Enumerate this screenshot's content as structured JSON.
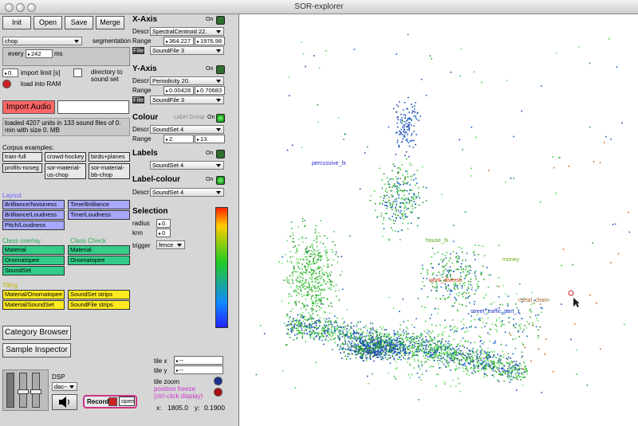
{
  "window": {
    "title": "SOR-explorer"
  },
  "toolbar": {
    "init": "Init",
    "open": "Open",
    "save": "Save",
    "merge": "Merge"
  },
  "segmentation": {
    "method": "chop",
    "label": "segmentation",
    "every_label": "every",
    "every_value": "242",
    "unit": "ms"
  },
  "import": {
    "limit_value": "0.",
    "limit_label": "import limit [s]",
    "dir_label": "directory to sound set",
    "ram_label": "load into RAM",
    "button": "Import Audio",
    "status": "loaded 4207 units in 133 sound files of 0. min with size 0. MB"
  },
  "corpus": {
    "title": "Corpus examples:",
    "items": [
      "train-full",
      "crowd-hockey",
      "birds+planes",
      "profils-noseg",
      "sor-material-us-chop",
      "sor-material-bb-chop"
    ]
  },
  "layout": {
    "title": "Layout",
    "items": [
      "Brilliance/Noisiness",
      "Time/Brilliance",
      "Brilliance/Loudness",
      "Time/Loudness",
      "Pitch/Loudness"
    ],
    "color": "#8b82ff"
  },
  "class_overlay": {
    "title": "Class overlay",
    "items": [
      "Material",
      "Onomatopee",
      "SoundSet"
    ],
    "color": "#33cc66"
  },
  "class_check": {
    "title": "Class Check",
    "items": [
      "Material",
      "Onomatopee"
    ],
    "color": "#33cc66"
  },
  "tiling": {
    "title": "Tiling",
    "items": [
      "Material/Onomatopee",
      "SoundSet strips",
      "Material/SoundSet",
      "SoundFile strips"
    ],
    "color": "#ddc400"
  },
  "browsers": {
    "category": "Category Browser",
    "sample": "Sample Inspector"
  },
  "dsp": {
    "label": "DSP",
    "device": "dac~",
    "record": "Record",
    "open": "open"
  },
  "xaxis": {
    "title": "X-Axis",
    "on": "On",
    "descr_label": "Descr",
    "descr": "SpectralCentroid 22.",
    "range_label": "Range",
    "min": "364.227",
    "max": "1976.98",
    "file_label": "File",
    "file": "SoundFile 3"
  },
  "yaxis": {
    "title": "Y-Axis",
    "on": "On",
    "descr_label": "Descr",
    "descr": "Periodicity 20.",
    "range_label": "Range",
    "min": "0.00428",
    "max": "0.70683",
    "file_label": "File",
    "file": "SoundFile 3"
  },
  "colour": {
    "title": "Colour",
    "group": "Label Group",
    "on": "On",
    "descr_label": "Descr",
    "descr": "SoundSet 4",
    "range_label": "Range",
    "min": "2.",
    "max": "13."
  },
  "labels": {
    "title": "Labels",
    "on": "On",
    "descr": "SoundSet 4"
  },
  "label_colour": {
    "title": "Label-colour",
    "on": "On",
    "descr_label": "Descr",
    "descr": "SoundSet 4"
  },
  "selection": {
    "title": "Selection",
    "radius_label": "radius",
    "radius": "0.",
    "knn_label": "knn",
    "knn": "0",
    "trigger_label": "trigger",
    "trigger": "fence"
  },
  "tiles": {
    "x_label": "tile x",
    "x_val": "--",
    "y_label": "tile y",
    "y_val": "--",
    "zoom_label": "tile zoom",
    "freeze": "position freeze",
    "freeze_hint": "(ctrl-click display)"
  },
  "coords": {
    "x_label": "x:",
    "x": "1805.0",
    "y_label": "y:",
    "y": "0.1900"
  },
  "plot": {
    "labels": [
      {
        "text": "percussive_fx",
        "color": "#2a2acc"
      },
      {
        "text": "house_fx",
        "color": "#55aa22"
      },
      {
        "text": "money",
        "color": "#77aa22"
      },
      {
        "text": "work_diverse",
        "color": "#cc3311"
      },
      {
        "text": "metal_chain",
        "color": "#aa6622"
      },
      {
        "text": "street_traffic_part_1",
        "color": "#2233cc"
      }
    ],
    "point_colors": [
      "#2a9a2a",
      "#44cc44",
      "#1560c0",
      "#2244aa",
      "#66dd66"
    ]
  }
}
